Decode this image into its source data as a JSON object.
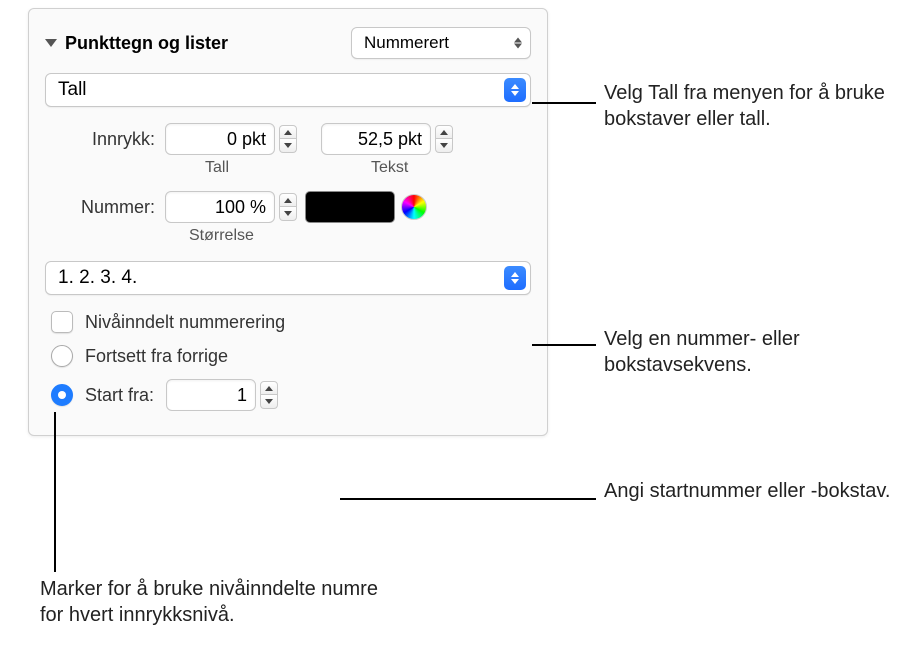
{
  "header": {
    "title": "Punkttegn og lister",
    "list_type": "Nummerert"
  },
  "type_select": "Tall",
  "indent": {
    "label": "Innrykk:",
    "tall_value": "0 pkt",
    "tall_label": "Tall",
    "tekst_value": "52,5 pkt",
    "tekst_label": "Tekst"
  },
  "number": {
    "label": "Nummer:",
    "size_value": "100 %",
    "size_label": "Størrelse"
  },
  "sequence_select": "1. 2. 3. 4.",
  "tiered_label": "Nivåinndelt nummerering",
  "continue_label": "Fortsett fra forrige",
  "startfrom": {
    "label": "Start fra:",
    "value": "1"
  },
  "callouts": {
    "c1": "Velg Tall fra menyen for å bruke bokstaver eller tall.",
    "c2": "Velg en nummer- eller bokstavsekvens.",
    "c3": "Angi startnummer eller -bokstav.",
    "c4": "Marker for å bruke nivåinndelte numre for hvert innrykksnivå."
  }
}
